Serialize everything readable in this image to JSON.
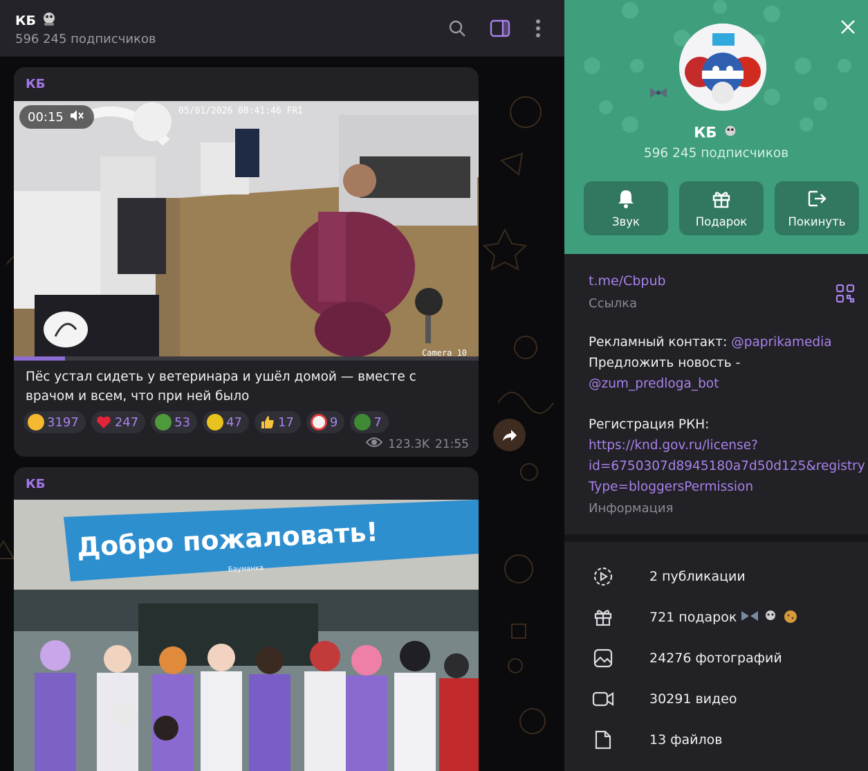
{
  "chat_header": {
    "title": "КБ",
    "subscribers": "596 245 подписчиков",
    "icons": [
      "search-icon",
      "sidebar-toggle-icon",
      "more-vertical-icon"
    ]
  },
  "messages": [
    {
      "author": "КБ",
      "media_type": "video",
      "duration": "00:15",
      "video_overlay_text": "05/01/2026 08:41:46 FRI",
      "camera_label": "Camera 10",
      "progress": 0.11,
      "caption": "Пёс устал сидеть у ветеринара и ушёл домой — вместе с врачом и всем, что при ней было",
      "reactions": [
        {
          "emoji": "rofl",
          "count": "3197"
        },
        {
          "emoji": "heart",
          "count": "247"
        },
        {
          "emoji": "pepe",
          "count": "53"
        },
        {
          "emoji": "smirk",
          "count": "47"
        },
        {
          "emoji": "thumbs-up",
          "count": "17"
        },
        {
          "emoji": "clown",
          "count": "9"
        },
        {
          "emoji": "pepe-sad",
          "count": "7"
        }
      ],
      "views": "123.3K",
      "time": "21:55"
    },
    {
      "author": "КБ",
      "media_type": "photo",
      "banner_text": "Добро пожаловать!",
      "banner_small_text": "Бауманка"
    }
  ],
  "panel": {
    "name": "КБ",
    "subscribers": "596 245 подписчиков",
    "actions": [
      {
        "label": "Звук",
        "icon": "bell-icon"
      },
      {
        "label": "Подарок",
        "icon": "gift-icon"
      },
      {
        "label": "Покинуть",
        "icon": "leave-icon"
      }
    ],
    "link": "t.me/Cbpub",
    "link_caption": "Ссылка",
    "ad_contact_label": "Рекламный  контакт: ",
    "ad_contact_handle": "@paprikamedia",
    "suggest_label": "Предложить новость  -",
    "suggest_handle": "@zum_predloga_bot",
    "rkn_label": "Регистрация РКН:",
    "rkn_url_1": "https://knd.gov.ru/license?",
    "rkn_url_2": "id=6750307d8945180a7d50d125&registry",
    "rkn_url_3": "Type=bloggersPermission",
    "info_caption": "Информация",
    "stats": [
      {
        "label": "2 публикации",
        "icon": "stories-icon"
      },
      {
        "label": "721 подарок",
        "icon": "gift-icon"
      },
      {
        "label": "24276 фотографий",
        "icon": "photo-icon"
      },
      {
        "label": "30291 видео",
        "icon": "video-icon"
      },
      {
        "label": "13 файлов",
        "icon": "file-icon"
      }
    ]
  },
  "colors": {
    "accent": "#a982ea",
    "panel_header": "#3f9e7c",
    "chat_bg": "#0b0b0d",
    "bubble": "#212126"
  }
}
